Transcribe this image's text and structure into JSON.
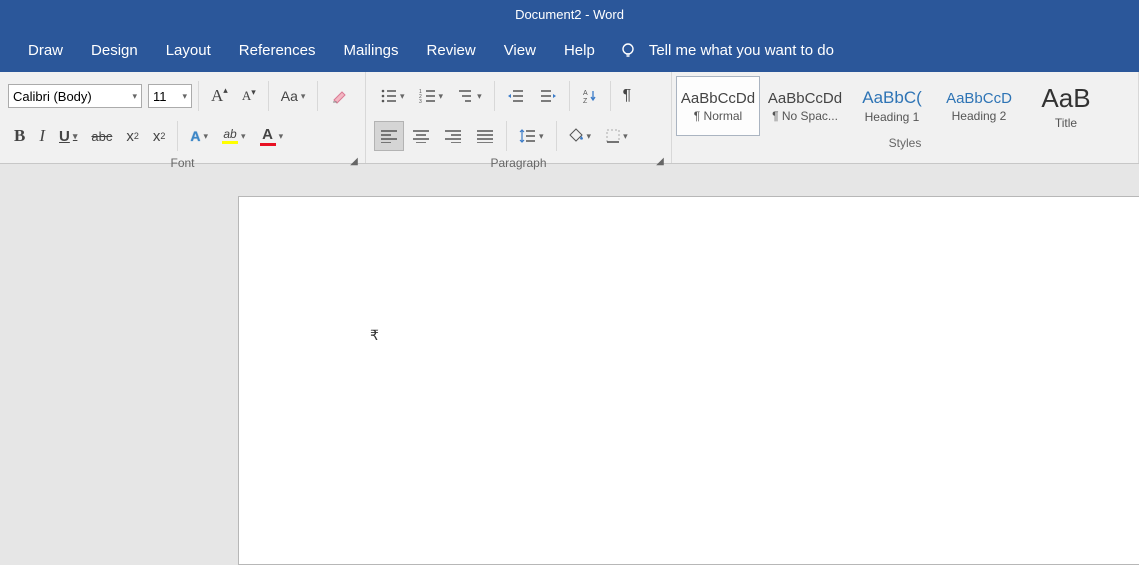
{
  "title": "Document2  -  Word",
  "tabs": [
    "Draw",
    "Design",
    "Layout",
    "References",
    "Mailings",
    "Review",
    "View",
    "Help"
  ],
  "tell_me": "Tell me what you want to do",
  "font": {
    "family": "Calibri (Body)",
    "size": "11",
    "group_label": "Font",
    "bold": "B",
    "italic": "I",
    "underline": "U",
    "strike": "abc",
    "sub_base": "x",
    "sup_base": "x",
    "change_case": "Aa",
    "text_effects": "A",
    "highlight": "ab",
    "font_color": "A"
  },
  "paragraph": {
    "group_label": "Paragraph"
  },
  "styles": {
    "group_label": "Styles",
    "items": [
      {
        "sample": "AaBbCcDd",
        "name": "¶ Normal",
        "kind": "normal"
      },
      {
        "sample": "AaBbCcDd",
        "name": "¶ No Spac...",
        "kind": "normal"
      },
      {
        "sample": "AaBbC(",
        "name": "Heading 1",
        "kind": "heading"
      },
      {
        "sample": "AaBbCcD",
        "name": "Heading 2",
        "kind": "heading"
      },
      {
        "sample": "AaB",
        "name": "Title",
        "kind": "title"
      }
    ]
  },
  "document": {
    "cursor_glyph": "₹"
  }
}
